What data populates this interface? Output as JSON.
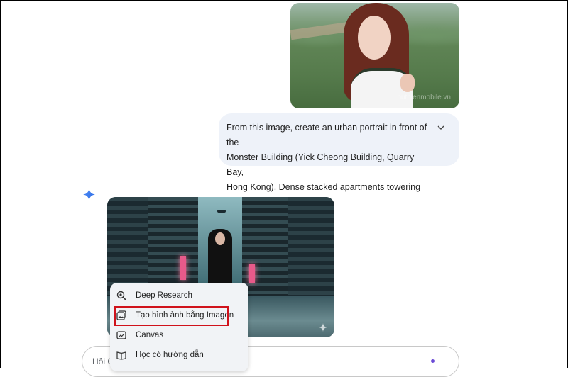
{
  "conversation": {
    "user_image_watermark": "huthienmobile.vn",
    "prompt_text_lines": [
      "From this image, create an urban portrait in front of the",
      "Monster Building (Yick Cheong Building, Quarry Bay,",
      "Hong Kong). Dense stacked apartments towering abov..."
    ],
    "expand_icon": "chevron-down-icon",
    "assistant_icon": "gemini-spark-icon",
    "generated_image_icon": "sparkle-icon"
  },
  "tools_menu": {
    "items": [
      {
        "label": "Deep Research",
        "icon": "deep-research-icon"
      },
      {
        "label": "Tạo hình ảnh bằng Imagen",
        "icon": "image-gen-icon",
        "highlighted": true
      },
      {
        "label": "Canvas",
        "icon": "canvas-icon"
      },
      {
        "label": "Học có hướng dẫn",
        "icon": "guided-learning-icon"
      }
    ]
  },
  "input": {
    "placeholder": "Hỏi G"
  },
  "colors": {
    "highlight": "#d0121b",
    "accent": "#6b4bd6",
    "prompt_bg": "#eef2f9"
  }
}
